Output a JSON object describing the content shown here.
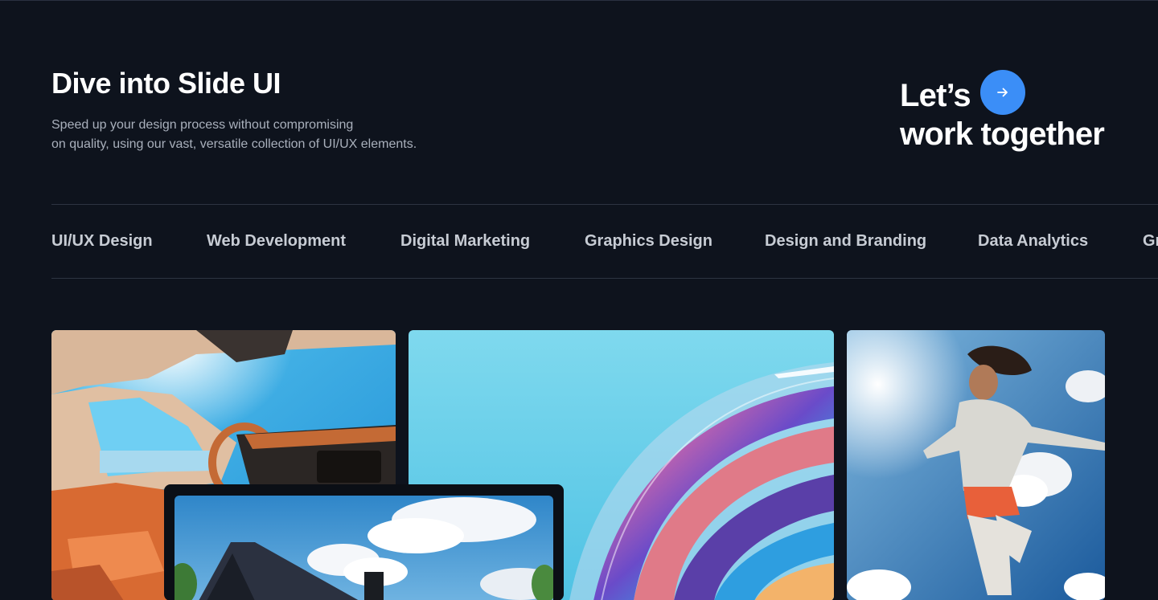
{
  "header": {
    "title": "Dive into Slide UI",
    "description_line1": "Speed up your design process without compromising",
    "description_line2": "on quality, using our vast, versatile collection of UI/UX elements."
  },
  "cta": {
    "line1": "Let’s",
    "line2": "work together",
    "button_icon": "arrow-right-icon",
    "accent_color": "#3b8ef7"
  },
  "categories": [
    "UI/UX Design",
    "Web Development",
    "Digital Marketing",
    "Graphics Design",
    "Design and Branding",
    "Data Analytics",
    "Gr"
  ],
  "gallery": {
    "items": [
      "car-interior-image",
      "abstract-swirl-image",
      "runner-image",
      "house-image"
    ]
  },
  "colors": {
    "background": "#0e131d",
    "divider": "#2d3442",
    "muted_text": "#a9b0bc",
    "tab_text": "#c7ccd4"
  }
}
